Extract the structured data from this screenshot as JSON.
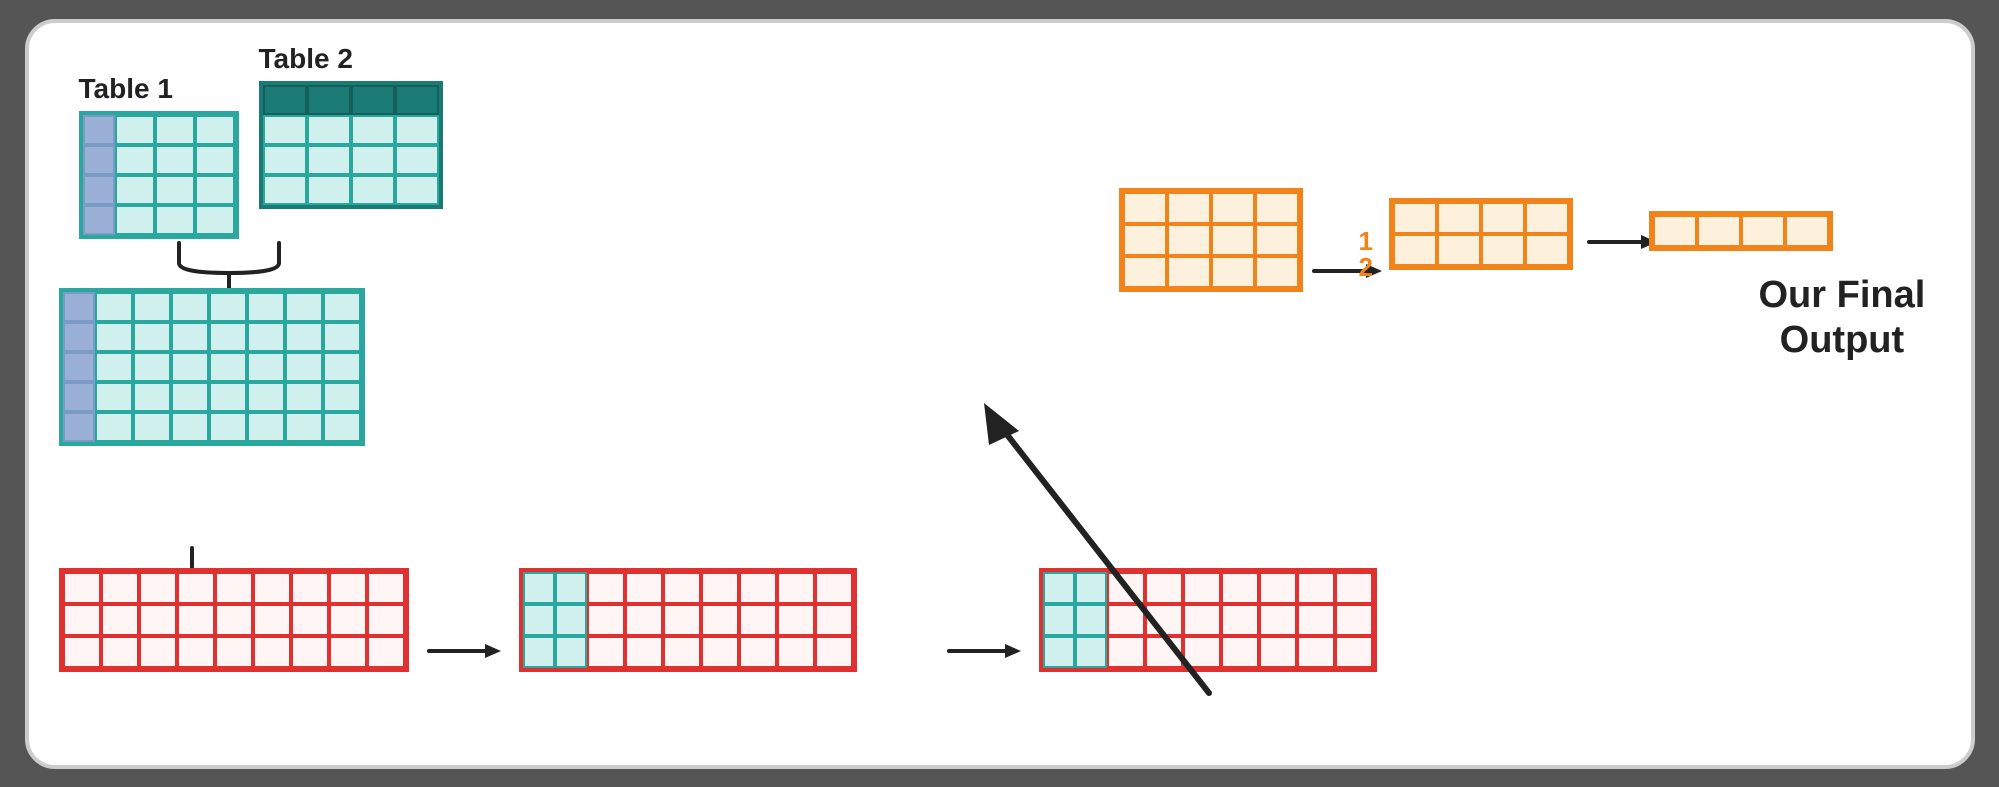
{
  "labels": {
    "table1": "Table 1",
    "table2": "Table 2",
    "final_output_line1": "Our Final",
    "final_output_line2": "Output",
    "half": "1\n2"
  },
  "colors": {
    "teal": "#2aa8a0",
    "dark_teal": "#1a7a74",
    "blue_purple": "#9ab0d6",
    "red": "#e03030",
    "orange": "#f0841a",
    "text": "#222222"
  }
}
